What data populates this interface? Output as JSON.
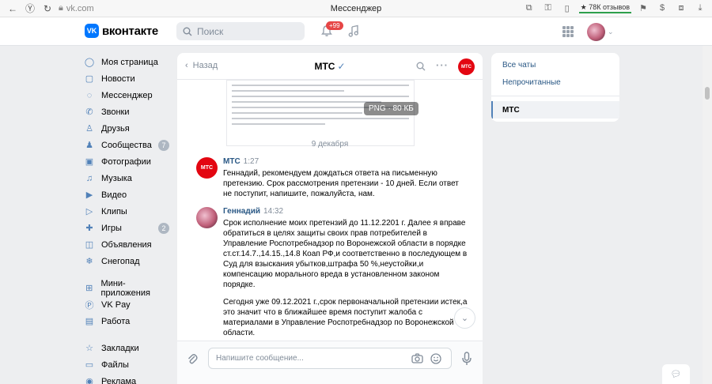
{
  "browser": {
    "url": "vk.com",
    "title": "Мессенджер",
    "reviews": "★ 78К отзывов"
  },
  "header": {
    "logo_text": "вконтакте",
    "logo_mark": "VK",
    "search_placeholder": "Поиск",
    "notifications_badge": "+99"
  },
  "sidebar": {
    "items": [
      {
        "label": "Моя страница",
        "icon": "user-circle-icon"
      },
      {
        "label": "Новости",
        "icon": "news-icon"
      },
      {
        "label": "Мессенджер",
        "icon": "messenger-icon"
      },
      {
        "label": "Звонки",
        "icon": "phone-icon"
      },
      {
        "label": "Друзья",
        "icon": "friends-icon"
      },
      {
        "label": "Сообщества",
        "icon": "communities-icon",
        "count": "7"
      },
      {
        "label": "Фотографии",
        "icon": "photo-icon"
      },
      {
        "label": "Музыка",
        "icon": "music-icon"
      },
      {
        "label": "Видео",
        "icon": "video-icon"
      },
      {
        "label": "Клипы",
        "icon": "clips-icon"
      },
      {
        "label": "Игры",
        "icon": "games-icon",
        "count": "2"
      },
      {
        "label": "Объявления",
        "icon": "ads-icon"
      },
      {
        "label": "Снегопад",
        "icon": "snowflake-icon"
      },
      {
        "label": "Мини-приложения",
        "icon": "apps-icon"
      },
      {
        "label": "VK Pay",
        "icon": "vkpay-icon"
      },
      {
        "label": "Работа",
        "icon": "work-icon"
      },
      {
        "label": "Закладки",
        "icon": "bookmark-icon"
      },
      {
        "label": "Файлы",
        "icon": "files-icon"
      },
      {
        "label": "Реклама",
        "icon": "advertising-icon"
      }
    ]
  },
  "chat": {
    "back_label": "Назад",
    "name": "МТС",
    "verified": "✓",
    "attachment_badge": "PNG · 80 КБ",
    "date_separator": "9 декабря",
    "messages": [
      {
        "author": "МТС",
        "time": "1:27",
        "paragraphs": [
          "Геннадий, рекомендуем дождаться ответа на письменную претензию. Срок рассмотрения претензии - 10 дней. Если ответ не поступит, напишите, пожалуйста, нам."
        ]
      },
      {
        "author": "Геннадий",
        "time": "14:32",
        "paragraphs": [
          "Срок исполнение моих претензий до 11.12.2201 г. Далее я вправе обратиться в целях защиты своих прав потребителей в Управление Роспотребнадзор по Воронежской области в порядке ст.ст.14.7.,14.15.,14.8 Коап РФ,и соответственно в последующем в Суд для взыскания убытков,штрафа 50 %,неустойки,и компенсацию морального вреда в установленном законом порядке.",
          "Сегодня уже 09.12.2021 г.,срок первоначальной претензии истек,а это значит что в ближайшее время поступит жалоба с материалами в Управление Роспотребнадзор по Воронежской области."
        ]
      }
    ],
    "composer_placeholder": "Напишите сообщение..."
  },
  "right_panel": {
    "items": [
      "Все чаты",
      "Непрочитанные"
    ],
    "selected": "МТС"
  },
  "colors": {
    "accent": "#5181b8",
    "brand_blue": "#0077ff",
    "mts_red": "#e30611",
    "page_bg": "#edeef0"
  }
}
